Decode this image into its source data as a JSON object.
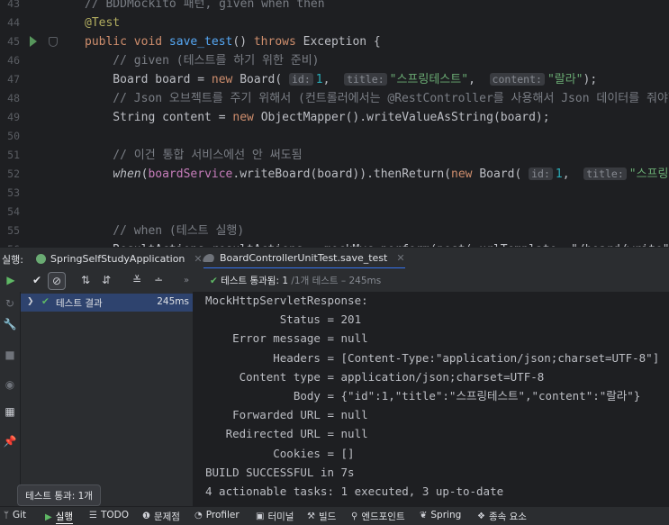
{
  "editor": {
    "lines": [
      {
        "n": "43",
        "parts": [
          {
            "t": "// BDDMockito 패턴, given when then",
            "c": "cm"
          }
        ]
      },
      {
        "n": "44",
        "parts": [
          {
            "t": "@Test",
            "c": "ann"
          }
        ]
      },
      {
        "n": "45",
        "parts": [
          {
            "t": "public void ",
            "c": "kw"
          },
          {
            "t": "save_test",
            "c": "fn"
          },
          {
            "t": "() ",
            "c": ""
          },
          {
            "t": "throws ",
            "c": "kw"
          },
          {
            "t": "Exception {",
            "c": ""
          }
        ]
      },
      {
        "n": "46",
        "parts": [
          {
            "t": "    // given (테스트를 하기 위한 준비)",
            "c": "cm"
          }
        ]
      },
      {
        "n": "47",
        "parts": [
          {
            "t": "    Board board = ",
            "c": ""
          },
          {
            "t": "new ",
            "c": "kw"
          },
          {
            "t": "Board( ",
            "c": ""
          },
          {
            "t": "id:",
            "c": "hint"
          },
          {
            "t": "1",
            "c": "num"
          },
          {
            "t": ",  ",
            "c": ""
          },
          {
            "t": "title:",
            "c": "hint"
          },
          {
            "t": "\"스프링테스트\"",
            "c": "str"
          },
          {
            "t": ",  ",
            "c": ""
          },
          {
            "t": "content:",
            "c": "hint"
          },
          {
            "t": "\"랄라\"",
            "c": "str"
          },
          {
            "t": ");",
            "c": ""
          }
        ]
      },
      {
        "n": "48",
        "parts": [
          {
            "t": "    // Json 오브젝트를 주기 위해서 (컨트롤러에서는 @RestController를 사용해서 Json 데이터를 줘야함 = Ob",
            "c": "cm"
          }
        ]
      },
      {
        "n": "49",
        "parts": [
          {
            "t": "    String content = ",
            "c": ""
          },
          {
            "t": "new ",
            "c": "kw"
          },
          {
            "t": "ObjectMapper().writeValueAsString(board);",
            "c": ""
          }
        ]
      },
      {
        "n": "50",
        "parts": []
      },
      {
        "n": "51",
        "parts": [
          {
            "t": "    // 이건 통합 서비스에선 안 써도됨",
            "c": "cm"
          }
        ]
      },
      {
        "n": "52",
        "parts": [
          {
            "t": "    ",
            "c": ""
          },
          {
            "t": "when",
            "c": "it"
          },
          {
            "t": "(",
            "c": ""
          },
          {
            "t": "boardService",
            "c": "field"
          },
          {
            "t": ".writeBoard(board)).thenReturn(",
            "c": ""
          },
          {
            "t": "new ",
            "c": "kw"
          },
          {
            "t": "Board( ",
            "c": ""
          },
          {
            "t": "id:",
            "c": "hint"
          },
          {
            "t": "1",
            "c": "num"
          },
          {
            "t": ",  ",
            "c": ""
          },
          {
            "t": "title:",
            "c": "hint"
          },
          {
            "t": "\"스프링테스트\"",
            "c": "str"
          },
          {
            "t": ",  c",
            "c": ""
          }
        ]
      },
      {
        "n": "53",
        "parts": []
      },
      {
        "n": "54",
        "parts": []
      },
      {
        "n": "55",
        "parts": [
          {
            "t": "    // when (테스트 실행)",
            "c": "cm"
          }
        ]
      },
      {
        "n": "56",
        "parts": [
          {
            "t": "    ResultActions resultActions = mockMvc.perform(post( urlTemplate: \"/board/write\")",
            "c": ""
          }
        ]
      }
    ]
  },
  "tool_window": {
    "label": "실행:",
    "tabs": [
      {
        "label": "SpringSelfStudyApplication"
      },
      {
        "label": "BoardControllerUnitTest.save_test"
      }
    ]
  },
  "toolbar": {
    "pass_label": "테스트 통과됨: 1",
    "pass_sub": "/1개 테스트 – 245ms"
  },
  "tree": {
    "root_label": "테스트 결과",
    "root_time": "245ms"
  },
  "console": {
    "lines": [
      "MockHttpServletResponse:",
      "           Status = 201",
      "    Error message = null",
      "          Headers = [Content-Type:\"application/json;charset=UTF-8\"]",
      "     Content type = application/json;charset=UTF-8",
      "             Body = {\"id\":1,\"title\":\"스프링테스트\",\"content\":\"랄라\"}",
      "    Forwarded URL = null",
      "   Redirected URL = null",
      "          Cookies = []",
      "BUILD SUCCESSFUL in 7s",
      "4 actionable tasks: 1 executed, 3 up-to-date"
    ]
  },
  "tooltip": {
    "text": "테스트 통과: 1개"
  },
  "bottom_bar": {
    "git": "Git",
    "run": "실행",
    "todo": "TODO",
    "problems": "문제점",
    "profiler": "Profiler",
    "terminal": "터미널",
    "build": "빌드",
    "endpoints": "엔드포인트",
    "spring": "Spring",
    "deps": "종속 요소"
  }
}
